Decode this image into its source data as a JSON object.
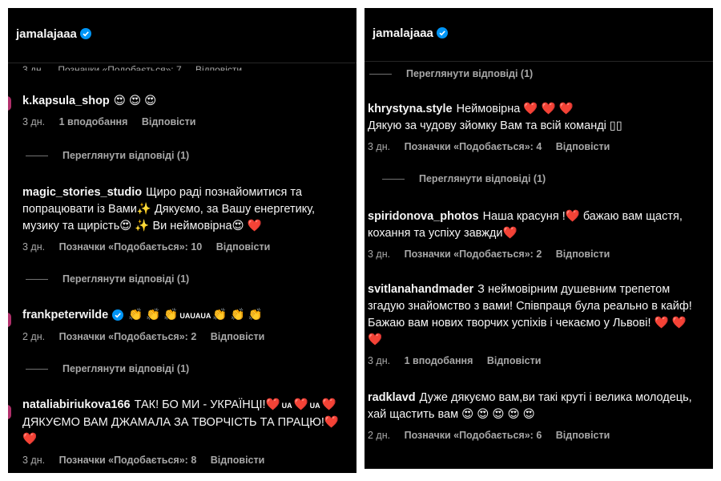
{
  "left": {
    "header": {
      "username": "jamalajaaa"
    },
    "cut_row": {
      "time": "3 дн.",
      "likes": "Позначки «Подобається»: 7",
      "reply": "Відповісти"
    },
    "comments": [
      {
        "user": "k.kapsula_shop",
        "text": "😍 😍 😍",
        "time": "3 дн.",
        "likes": "1 вподобання",
        "reply": "Відповісти",
        "view_replies": "Переглянути відповіді (1)"
      },
      {
        "user": "magic_stories_studio",
        "text_1": "Щиро раді познайомитися та попрацювати із Вами",
        "text_2": "✨",
        "text_3": " Дякуємо, за Вашу енергетику, музику та щирість",
        "text_4": "😍 ✨",
        "text_5": " Ви неймовірна",
        "text_6": "😍 ❤️",
        "time": "3 дн.",
        "likes": "Позначки «Подобається»: 10",
        "reply": "Відповісти",
        "view_replies": "Переглянути відповіді (1)"
      },
      {
        "user": "frankpeterwilde",
        "text_1": "👏 👏 👏",
        "text_2": "UAUAUA",
        "text_3": "👏 👏 👏",
        "time": "2 дн.",
        "likes": "Позначки «Подобається»: 2",
        "reply": "Відповісти",
        "view_replies": "Переглянути відповіді (1)"
      },
      {
        "user": "nataliabiriukova166",
        "text_1": "ТАК! БО МИ - УКРАЇНЦІ!",
        "text_2": "❤️",
        "text_3": "UA",
        "text_4": "❤️",
        "text_5": "UA",
        "text_6": "❤️",
        "text_7": "ДЯКУЄМО ВАМ ДЖАМАЛА ЗА ТВОРЧІСТЬ ТА ПРАЦЮ!",
        "text_8": "❤️ ❤️",
        "time": "3 дн.",
        "likes": "Позначки «Подобається»: 8",
        "reply": "Відповісти"
      }
    ]
  },
  "right": {
    "header": {
      "username": "jamalajaaa"
    },
    "top_view_replies": "Переглянути відповіді (1)",
    "comments": [
      {
        "user": "khrystyna.style",
        "text_1": "Неймовірна",
        "text_2": "❤️ ❤️ ❤️",
        "text_3": "Дякую за чудову зйомку Вам та всій команді",
        "text_4": "▯▯",
        "time": "3 дн.",
        "likes": "Позначки «Подобається»: 4",
        "reply": "Відповісти",
        "view_replies": "Переглянути відповіді (1)"
      },
      {
        "user": "spiridonova_photos",
        "text_1": "Наша красуня !",
        "text_2": "❤️",
        "text_3": " бажаю вам щастя, кохання та успіху завжди",
        "text_4": "❤️",
        "time": "3 дн.",
        "likes": "Позначки «Подобається»: 2",
        "reply": "Відповісти"
      },
      {
        "user": "svitlanahandmader",
        "text_1": "З неймовірним душевним трепетом згадую знайомство з вами! Співпраця була реально в кайф! Бажаю вам нових творчих успіхів і чекаємо у Львові!",
        "text_2": "❤️ ❤️ ❤️",
        "time": "3 дн.",
        "likes": "1 вподобання",
        "reply": "Відповісти"
      },
      {
        "user": "radklavd",
        "text_1": "Дуже дякуємо вам,ви такі круті і велика молодець, хай щастить вам",
        "text_2": "😍 😍 😍 😍 😍",
        "time": "2 дн.",
        "likes": "Позначки «Подобається»: 6",
        "reply": "Відповісти"
      }
    ]
  },
  "colors": {
    "background": "#000000",
    "text": "#f5f5f5",
    "secondary": "#a8a8a8",
    "verified": "#0095f6",
    "heart": "#ed1c45"
  },
  "icons": [
    "verified-badge-icon"
  ]
}
